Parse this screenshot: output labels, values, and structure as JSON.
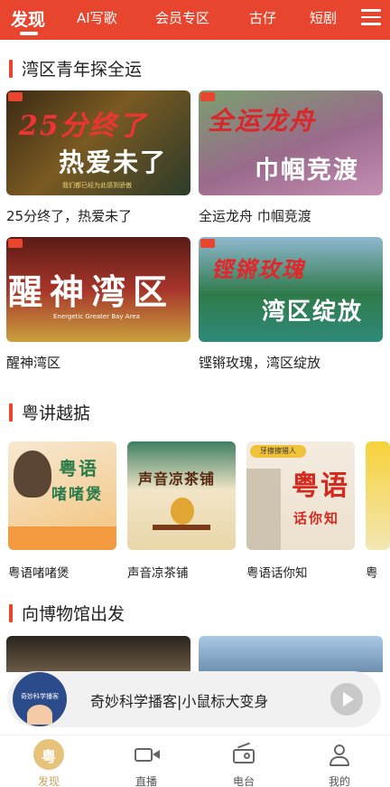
{
  "topnav": {
    "tabs": [
      "发现",
      "AI写歌",
      "会员专区",
      "古仔",
      "短剧"
    ],
    "active_index": 0,
    "menu_icon": "menu-icon"
  },
  "sections": {
    "bay_area": {
      "title": "湾区青年探全运",
      "cards": [
        {
          "caption": "25分终了，热爱未了",
          "thumb_title": "25分终了",
          "thumb_title2": "热爱未了",
          "thumb_sub": "我们都已经为此感到骄傲"
        },
        {
          "caption": "全运龙舟 巾帼竞渡",
          "thumb_title": "全运龙舟",
          "thumb_title2": "巾帼竞渡"
        },
        {
          "caption": "醒神湾区",
          "thumb_title": "醒神湾区",
          "thumb_sub": "Energetic Greater Bay Area"
        },
        {
          "caption": "铿锵玫瑰，湾区绽放",
          "thumb_title": "铿锵玫瑰",
          "thumb_title2": "湾区绽放"
        }
      ]
    },
    "cantonese": {
      "title": "粤讲越掂",
      "cards": [
        {
          "caption": "粤语啫啫煲",
          "thumb_title": "粤语",
          "thumb_title2": "啫啫煲"
        },
        {
          "caption": "声音凉茶铺",
          "thumb_title": "声音凉茶铺"
        },
        {
          "caption": "粤语话你知",
          "thumb_title": "粤语",
          "thumb_title2": "话你知",
          "thumb_badge": "牙擦擦猎人"
        },
        {
          "caption": "粤"
        }
      ]
    },
    "museum": {
      "title": "向博物馆出发"
    }
  },
  "player": {
    "title": "奇妙科学播客|小鼠标大变身",
    "cover_text": "奇妙科学播客"
  },
  "tabbar": {
    "items": [
      {
        "label": "发现",
        "icon": "discover-icon"
      },
      {
        "label": "直播",
        "icon": "live-camera-icon"
      },
      {
        "label": "电台",
        "icon": "radio-icon"
      },
      {
        "label": "我的",
        "icon": "profile-icon"
      }
    ],
    "active_index": 0,
    "active_icon_text": "粤"
  },
  "colors": {
    "accent": "#e8452e",
    "tab_active": "#c9a45c"
  }
}
